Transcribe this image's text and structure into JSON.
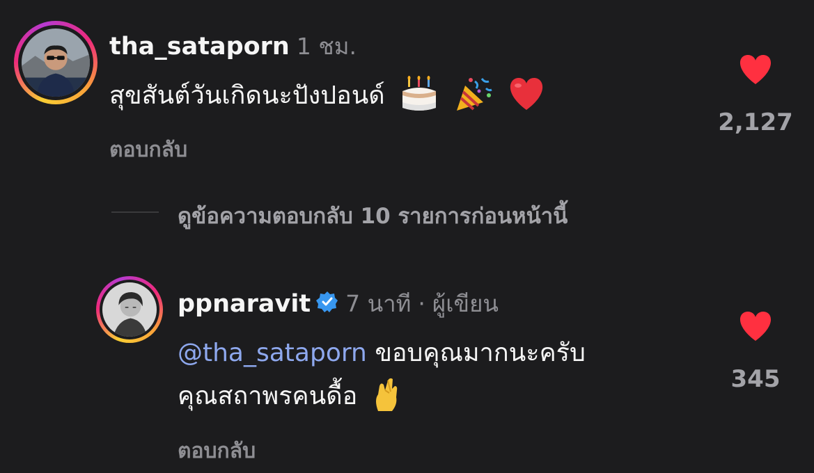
{
  "comment": {
    "username": "tha_sataporn",
    "time": "1 ชม.",
    "text": "สุขสันต์วันเกิดนะปังปอนด์",
    "emoji_icons": [
      "birthday-cake-icon",
      "party-popper-icon",
      "red-heart-icon"
    ],
    "reply_label": "ตอบกลับ",
    "like_count": "2,127",
    "heart_color": "#ff3040"
  },
  "view_previous": {
    "label": "ดูข้อความตอบกลับ 10 รายการก่อนหน้านี้"
  },
  "reply": {
    "username": "ppnaravit",
    "verified": true,
    "time": "7 นาที",
    "separator": "·",
    "author_label": "ผู้เขียน",
    "mention": "@tha_sataporn",
    "text_line1": "ขอบคุณมากนะครับ",
    "text_line2": "คุณสถาพรคนดื้อ",
    "emoji_icon": "crossed-fingers-icon",
    "reply_label": "ตอบกลับ",
    "like_count": "345",
    "heart_color": "#ff3040"
  }
}
